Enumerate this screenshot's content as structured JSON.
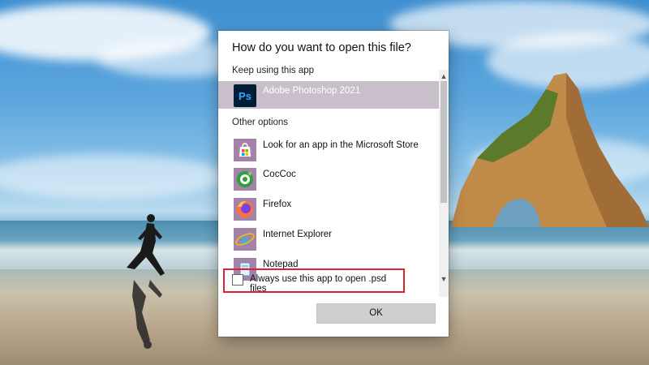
{
  "dialog": {
    "title": "How do you want to open this file?",
    "keep_label": "Keep using this app",
    "current_app": {
      "label": "Adobe Photoshop 2021",
      "icon": "photoshop-icon",
      "icon_text": "Ps"
    },
    "other_label": "Other options",
    "other_apps": [
      {
        "label": "Look for an app in the Microsoft Store",
        "icon": "store-icon"
      },
      {
        "label": "CocCoc",
        "icon": "coccoc-icon"
      },
      {
        "label": "Firefox",
        "icon": "firefox-icon"
      },
      {
        "label": "Internet Explorer",
        "icon": "ie-icon"
      },
      {
        "label": "Notepad",
        "icon": "notepad-icon"
      }
    ],
    "always_use_label": "Always use this app to open .psd files",
    "always_use_checked": false,
    "ok_label": "OK"
  },
  "colors": {
    "selected_row": "#c9bfca",
    "highlight_border": "#e0212e",
    "ok_button": "#cfcfcf"
  }
}
